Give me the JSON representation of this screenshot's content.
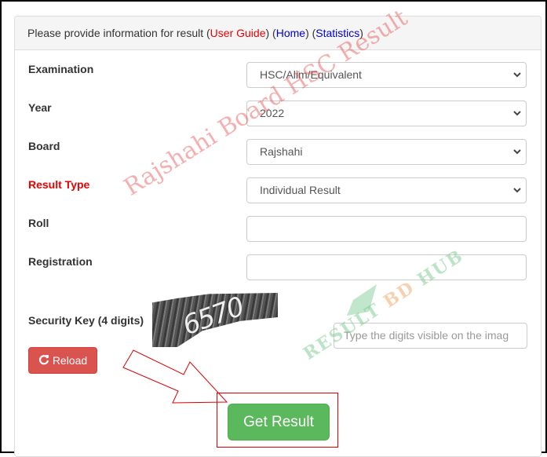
{
  "heading": {
    "prefix": "Please provide information for result (",
    "user_guide": "User Guide",
    "sep1": ") (",
    "home": "Home",
    "sep2": ") (",
    "statistics": "Statistics",
    "suffix": ")"
  },
  "form": {
    "examination": {
      "label": "Examination",
      "value": "HSC/Alim/Equivalent"
    },
    "year": {
      "label": "Year",
      "value": "2022"
    },
    "board": {
      "label": "Board",
      "value": "Rajshahi"
    },
    "result_type": {
      "label": "Result Type",
      "value": "Individual Result"
    },
    "roll": {
      "label": "Roll",
      "value": ""
    },
    "registration": {
      "label": "Registration",
      "value": ""
    },
    "security_key": {
      "label": "Security Key (4 digits)",
      "captcha_text": "6570",
      "placeholder": "Type the digits visible on the imag"
    }
  },
  "buttons": {
    "reload": "Reload",
    "get_result": "Get Result"
  },
  "watermarks": {
    "red": "Rajshahi Board HSC Result",
    "green_1": "RESULT ",
    "green_2": "BD",
    "green_3": " HUB"
  },
  "colors": {
    "accent_red": "#e00000",
    "link_blue": "#0000cc",
    "reload_bg": "#d9534f",
    "get_result_bg": "#5cb85c"
  }
}
